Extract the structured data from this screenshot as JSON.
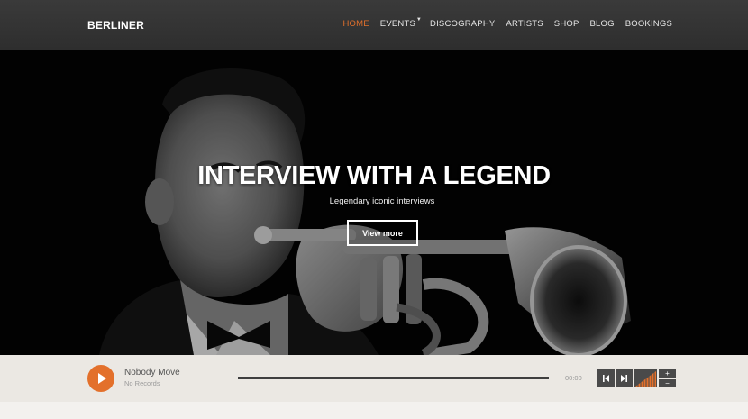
{
  "brand": {
    "logo": "BERLINER",
    "accent": "#e3702b"
  },
  "nav": {
    "items": [
      {
        "label": "HOME",
        "active": true
      },
      {
        "label": "EVENTS",
        "has_dropdown": true
      },
      {
        "label": "DISCOGRAPHY"
      },
      {
        "label": "ARTISTS"
      },
      {
        "label": "SHOP"
      },
      {
        "label": "BLOG"
      },
      {
        "label": "BOOKINGS"
      }
    ],
    "dropdown_icon": "caret-down-icon"
  },
  "hero": {
    "title": "INTERVIEW WITH A LEGEND",
    "subtitle": "Legendary iconic interviews",
    "button_label": "View more",
    "image": "trumpet-player-photo"
  },
  "player": {
    "track_title": "Nobody Move",
    "track_subtitle": "No Records",
    "time": "00:00",
    "progress": 0,
    "icons": [
      "play-icon",
      "previous-icon",
      "next-icon",
      "volume-bars-icon"
    ],
    "volume_up_label": "+",
    "volume_down_label": "−"
  }
}
